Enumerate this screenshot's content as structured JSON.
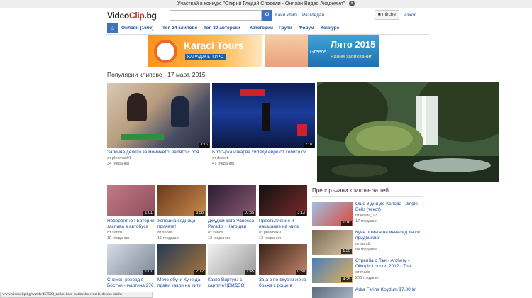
{
  "promo": {
    "text": "Участвай в конкурс \"Открий Гледай Сподели - Онлайн Видео Академия\"",
    "close": "x"
  },
  "header": {
    "logo_video": "Video",
    "logo_clip": "Clip",
    "logo_bg": ".bg",
    "search_placeholder": "",
    "upload": "Качи клип",
    "browse": "Разгледай",
    "user": "mirche",
    "logout": "Изход"
  },
  "nav": {
    "items": [
      "Онлайн (1566)",
      "Топ 24 клипове",
      "Топ 30 авторски",
      "Категории",
      "Групи",
      "Форум",
      "Конкурс"
    ]
  },
  "banner": {
    "brand": "Karaci Tours",
    "sub": "КАРАДЖЪ ТУРС",
    "country": "Greece",
    "summer": "Лято 2015",
    "early": "Ранни записвания"
  },
  "popular": {
    "title": "Популярни клипове - 17 март, 2015",
    "featured": [
      {
        "title": "Започна делото за момичето, залято с боя",
        "author": "от pleomax91",
        "views": "34 гледания",
        "duration": "3:16"
      },
      {
        "title": "Блогърка изкарва хиляди евро от хобито си",
        "author": "от deserti",
        "views": "47 гледания",
        "duration": "2:07"
      }
    ],
    "grid": [
      {
        "title": "Невероятно ! Батерия заспива в автобуса",
        "author": "от sands",
        "views": "19 гледания",
        "duration": "1:01"
      },
      {
        "title": "Успешна седница прияете!",
        "author": "от sands",
        "views": "15 гледания",
        "duration": "3:58"
      },
      {
        "title": "Джуджи като Vanessa Paradis - Като дви",
        "author": "от sands",
        "views": "12 гледания",
        "duration": "10:35"
      },
      {
        "title": "Престъпление и наказание на мига",
        "author": "от pleomax91",
        "views": "12 гледания",
        "duration": "3:13"
      },
      {
        "title": "Снежен рекорд в Бостън - мартина 276",
        "author": "от sands",
        "views": "14 гледания",
        "duration": "1:01"
      },
      {
        "title": "Мечо обучи Куче да прави каври на Уити",
        "author": "от sands",
        "views": "13 гледания",
        "duration": "2:12"
      },
      {
        "title": "Какво Виртуоз с картите! [ВИДЕО]",
        "author": "от sands",
        "views": "23 гледания",
        "duration": "1:45"
      },
      {
        "title": "За а в по-вкусно жена брьжа с роще в",
        "author": "от sands",
        "views": "16 гледания",
        "duration": "0:30"
      }
    ]
  },
  "recommended": {
    "title": "Препоръчани клипове за теб",
    "items": [
      {
        "title": "Още 3 дни до Коледа - Jingle Bells (текст)",
        "author": "от kokita_17",
        "views": "17 гледания",
        "duration": "1:16"
      },
      {
        "title": "Куче помага на инвалид да се придвижва!",
        "author": "от sands",
        "views": "84 гледания",
        "duration": "1:55"
      },
      {
        "title": "Стрелба с Лък - Archery - Olimpic London 2012 - The",
        "author": "от mado",
        "views": "206 гледания",
        "duration": "4:25"
      },
      {
        "title": "Adra Feriha Koydum $7.80Ilm",
        "author": "",
        "views": "",
        "duration": ""
      }
    ]
  },
  "status": {
    "url": "www.videoclip.bg/watch/457520_zaiko-kara-trotinetka-wesela-detsko-stiche"
  },
  "colors": {
    "accent": "#3d74c1",
    "link": "#1f4f99",
    "brand_red": "#c1272d"
  }
}
